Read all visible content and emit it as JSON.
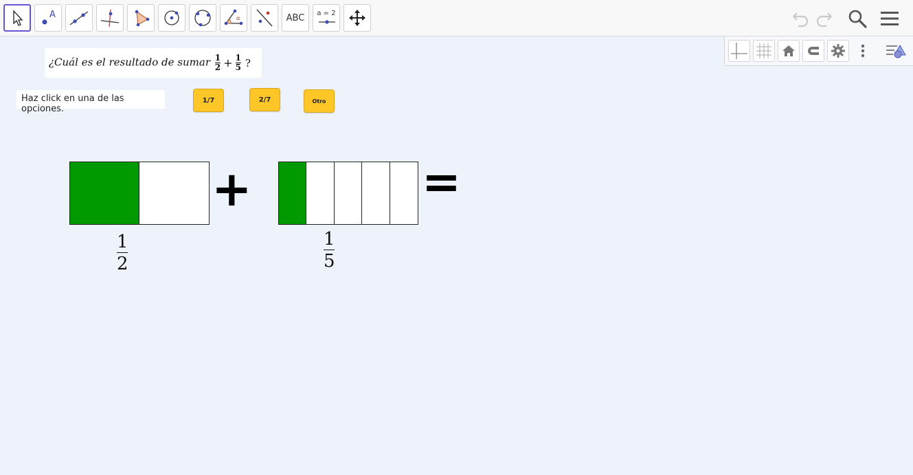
{
  "toolbar": {
    "tools": [
      {
        "name": "move-tool",
        "icon": "cursor-arrow-icon"
      },
      {
        "name": "point-tool",
        "icon": "point-icon"
      },
      {
        "name": "line-tool",
        "icon": "line-through-points-icon"
      },
      {
        "name": "perpendicular-tool",
        "icon": "perpendicular-line-icon"
      },
      {
        "name": "polygon-tool",
        "icon": "polygon-icon"
      },
      {
        "name": "circle-tool",
        "icon": "circle-center-point-icon"
      },
      {
        "name": "circle-three-points-tool",
        "icon": "circle-three-points-icon"
      },
      {
        "name": "angle-tool",
        "icon": "angle-icon"
      },
      {
        "name": "reflect-tool",
        "icon": "reflect-line-icon"
      },
      {
        "name": "text-tool",
        "label": "ABC"
      },
      {
        "name": "slider-tool",
        "label": "a = 2"
      },
      {
        "name": "move-view-tool",
        "icon": "move-arrows-icon"
      }
    ],
    "accent": "#6557d2"
  },
  "question": {
    "prefix": "¿Cuál es el resultado de sumar",
    "frac1_num": "1",
    "frac1_den": "2",
    "plus": "+",
    "frac2_num": "1",
    "frac2_den": "5",
    "suffix": "?"
  },
  "instruction": "Haz click en una de las opciones.",
  "options": [
    {
      "label": "1/7"
    },
    {
      "label": "2/7"
    },
    {
      "label": "Otro"
    }
  ],
  "option_color": "#ffc627",
  "fraction_a": {
    "numerator": "1",
    "denominator": "2",
    "parts": 2,
    "filled": 1
  },
  "fraction_b": {
    "numerator": "1",
    "denominator": "5",
    "parts": 5,
    "filled": 1
  },
  "fill_color": "#009900",
  "signs": {
    "plus": "+",
    "equals": "="
  }
}
